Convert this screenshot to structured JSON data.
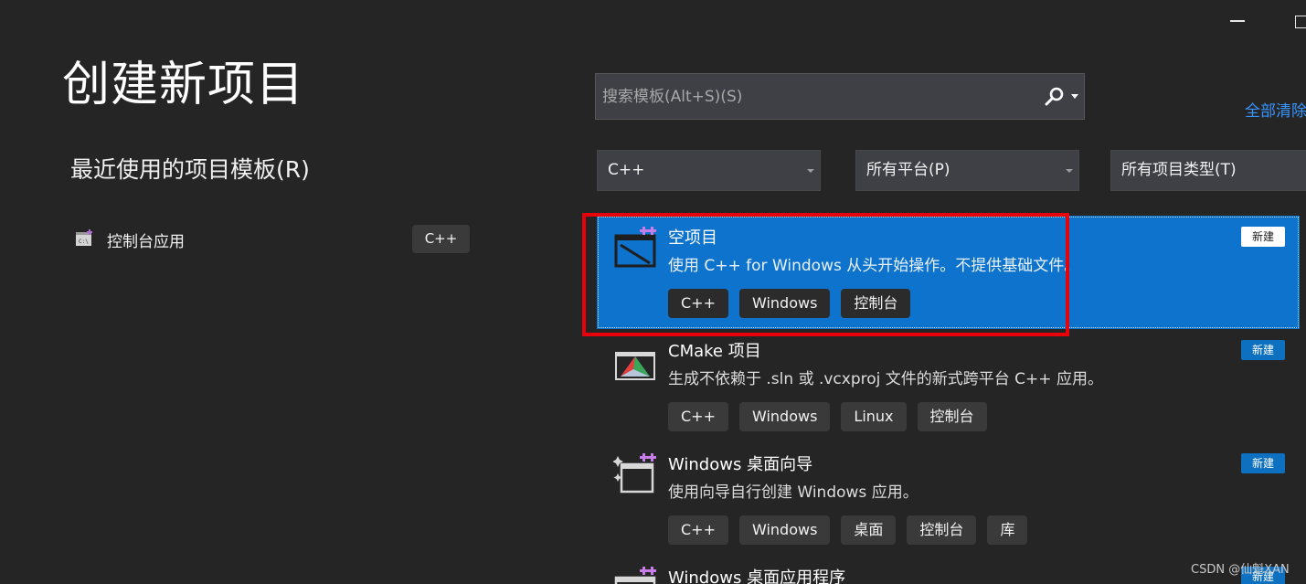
{
  "window": {
    "minimize_icon": "minimize-icon",
    "maximize_icon": "maximize-icon"
  },
  "page_title": "创建新项目",
  "recent": {
    "heading": "最近使用的项目模板(R)",
    "items": [
      {
        "label": "控制台应用",
        "tag": "C++",
        "icon": "console-app-icon"
      }
    ]
  },
  "search": {
    "placeholder": "搜索模板(Alt+S)(S)",
    "value": ""
  },
  "clear_all_label": "全部清除",
  "filters": {
    "language": "C++",
    "platform": "所有平台(P)",
    "project_type": "所有项目类型(T)"
  },
  "templates": [
    {
      "title": "空项目",
      "description": "使用 C++ for Windows 从头开始操作。不提供基础文件。",
      "tags": [
        "C++",
        "Windows",
        "控制台"
      ],
      "badge": "新建",
      "icon": "empty-project-icon",
      "selected": true
    },
    {
      "title": "CMake 项目",
      "description": "生成不依赖于 .sln 或 .vcxproj 文件的新式跨平台 C++ 应用。",
      "tags": [
        "C++",
        "Windows",
        "Linux",
        "控制台"
      ],
      "badge": "新建",
      "icon": "cmake-icon",
      "selected": false
    },
    {
      "title": "Windows 桌面向导",
      "description": "使用向导自行创建 Windows 应用。",
      "tags": [
        "C++",
        "Windows",
        "桌面",
        "控制台",
        "库"
      ],
      "badge": "新建",
      "icon": "desktop-wizard-icon",
      "selected": false
    },
    {
      "title": "Windows 桌面应用程序",
      "description": "",
      "tags": [],
      "badge": "新建",
      "icon": "desktop-app-icon",
      "selected": false
    }
  ],
  "colors": {
    "accent": "#0d73cc",
    "highlight": "#e8000b",
    "link": "#3794ff"
  },
  "watermark": "CSDN @仙魁XAN"
}
